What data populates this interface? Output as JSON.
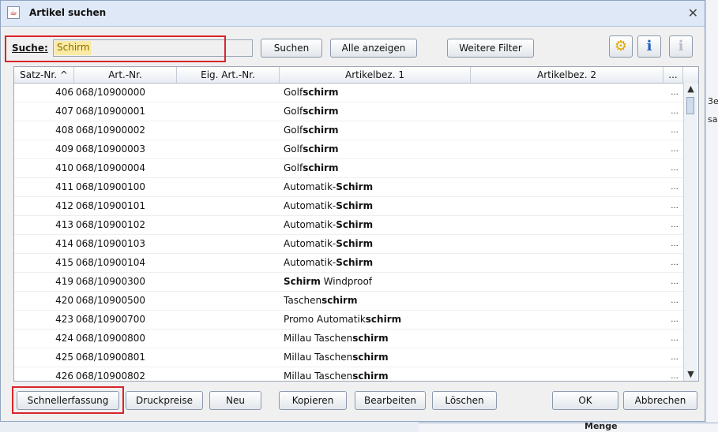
{
  "window": {
    "title": "Artikel suchen"
  },
  "search": {
    "label": "Suche:",
    "value": "Schirm"
  },
  "toolbar": {
    "suchen": "Suchen",
    "alle_anzeigen": "Alle anzeigen",
    "weitere_filter": "Weitere Filter"
  },
  "table": {
    "columns": [
      "Satz-Nr. ^",
      "Art.-Nr.",
      "Eig. Art.-Nr.",
      "Artikelbez. 1",
      "Artikelbez. 2",
      "..."
    ],
    "rows": [
      {
        "satz": "406",
        "art": "068/10900000",
        "pre": "Golf",
        "bold": "schirm",
        "post": ""
      },
      {
        "satz": "407",
        "art": "068/10900001",
        "pre": "Golf",
        "bold": "schirm",
        "post": ""
      },
      {
        "satz": "408",
        "art": "068/10900002",
        "pre": "Golf",
        "bold": "schirm",
        "post": ""
      },
      {
        "satz": "409",
        "art": "068/10900003",
        "pre": "Golf",
        "bold": "schirm",
        "post": ""
      },
      {
        "satz": "410",
        "art": "068/10900004",
        "pre": "Golf",
        "bold": "schirm",
        "post": ""
      },
      {
        "satz": "411",
        "art": "068/10900100",
        "pre": "Automatik-",
        "bold": "Schirm",
        "post": ""
      },
      {
        "satz": "412",
        "art": "068/10900101",
        "pre": "Automatik-",
        "bold": "Schirm",
        "post": ""
      },
      {
        "satz": "413",
        "art": "068/10900102",
        "pre": "Automatik-",
        "bold": "Schirm",
        "post": ""
      },
      {
        "satz": "414",
        "art": "068/10900103",
        "pre": "Automatik-",
        "bold": "Schirm",
        "post": ""
      },
      {
        "satz": "415",
        "art": "068/10900104",
        "pre": "Automatik-",
        "bold": "Schirm",
        "post": ""
      },
      {
        "satz": "419",
        "art": "068/10900300",
        "pre": "",
        "bold": "Schirm",
        "post": " Windproof"
      },
      {
        "satz": "420",
        "art": "068/10900500",
        "pre": "Taschen",
        "bold": "schirm",
        "post": ""
      },
      {
        "satz": "423",
        "art": "068/10900700",
        "pre": "Promo Automatik",
        "bold": "schirm",
        "post": ""
      },
      {
        "satz": "424",
        "art": "068/10900800",
        "pre": "Millau Taschen",
        "bold": "schirm",
        "post": ""
      },
      {
        "satz": "425",
        "art": "068/10900801",
        "pre": "Millau Taschen",
        "bold": "schirm",
        "post": ""
      },
      {
        "satz": "426",
        "art": "068/10900802",
        "pre": "Millau Taschen",
        "bold": "schirm",
        "post": ""
      }
    ],
    "row_dots": "..."
  },
  "footer": {
    "schnellerfassung": "Schnellerfassung",
    "druckpreise": "Druckpreise",
    "neu": "Neu",
    "kopieren": "Kopieren",
    "bearbeiten": "Bearbeiten",
    "loeschen": "Löschen",
    "ok": "OK",
    "abbrechen": "Abbrechen"
  },
  "background": {
    "text1": "3e",
    "text2": "sa",
    "label": "Menge"
  },
  "colors": {
    "highlight_box": "#d9242a",
    "search_highlight": "#fbeaa2",
    "titlebar": "#dfe8f6"
  }
}
